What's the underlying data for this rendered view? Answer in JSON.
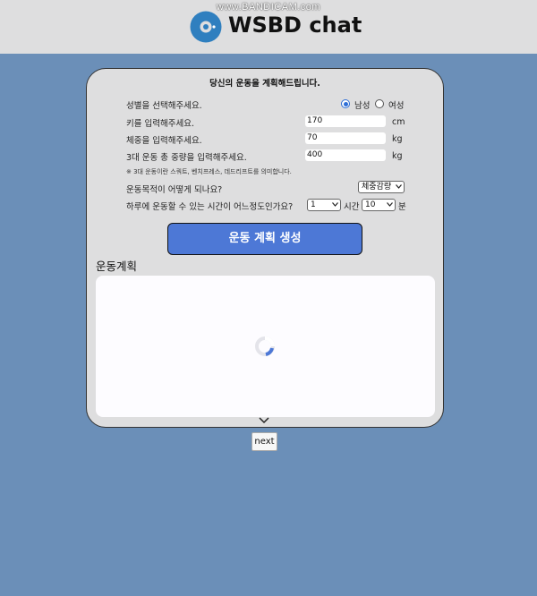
{
  "watermark": "www.BANDICAM.com",
  "app": {
    "title": "WSBD chat"
  },
  "form": {
    "title": "당신의 운동을 계획해드립니다.",
    "gender": {
      "label": "성별을 선택해주세요.",
      "options": [
        "남성",
        "여성"
      ],
      "selected": "남성"
    },
    "height": {
      "label": "키를 입력해주세요.",
      "value": "170",
      "unit": "cm"
    },
    "weight": {
      "label": "체중을 입력해주세요.",
      "value": "70",
      "unit": "kg"
    },
    "big3": {
      "label": "3대 운동 총 중량을 입력해주세요.",
      "value": "400",
      "unit": "kg"
    },
    "note": "※ 3대 운동이란 스쿼트, 벤치프레스, 데드리프트를 의미합니다.",
    "goal": {
      "label": "운동목적이 어떻게 되나요?",
      "selected": "체중감량"
    },
    "time": {
      "label": "하루에 운동할 수 있는 시간이 어느정도인가요?",
      "hours": "1",
      "hours_unit": "시간",
      "minutes": "10",
      "minutes_unit": "분"
    },
    "generate_label": "운동 계획 생성"
  },
  "plan": {
    "title": "운동계획"
  },
  "footer": {
    "next_label": "next"
  },
  "colors": {
    "background": "#6b8fb8",
    "accent": "#4d78d6",
    "card": "#dededf"
  },
  "icons": {
    "logo": "disc-logo-icon",
    "spinner": "loading-spinner-icon",
    "collapse": "chevron-down-icon"
  }
}
